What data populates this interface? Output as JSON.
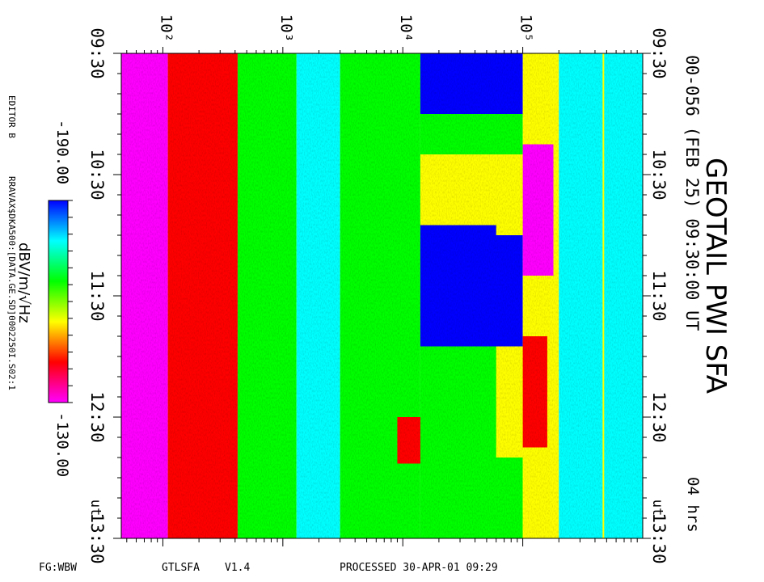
{
  "chart_data": {
    "type": "heatmap",
    "title": "GEOTAIL PWI SFA",
    "subtitle": "00-056 (FEB 25) 09:30:00 UT",
    "span_label": "04 hrs",
    "xscale": "log",
    "xlim": [
      45,
      1000000
    ],
    "x_ticks": [
      {
        "value": 100,
        "label": "10²"
      },
      {
        "value": 1000,
        "label": "10³"
      },
      {
        "value": 10000,
        "label": "10⁴"
      },
      {
        "value": 100000,
        "label": "10⁵"
      }
    ],
    "ylim": [
      "09:30",
      "13:30"
    ],
    "y_ticks": [
      "09:30",
      "10:30",
      "11:30",
      "12:30",
      "13:30"
    ],
    "y_unit_label": "UT",
    "colorbar": {
      "label": "dBV/m/√Hz",
      "min_label": "-190.00",
      "max_label": "-130.00",
      "min": -190,
      "max": -130,
      "colors": [
        "#ff00ff",
        "#ff0000",
        "#ffff00",
        "#00ff00",
        "#00ffff",
        "#0000ff"
      ]
    },
    "regions": [
      {
        "f_start": 45,
        "f_end": 110,
        "t_start": 0,
        "t_end": 240,
        "level": -133
      },
      {
        "f_start": 110,
        "f_end": 420,
        "t_start": 0,
        "t_end": 240,
        "level": -145
      },
      {
        "f_start": 420,
        "f_end": 1300,
        "t_start": 0,
        "t_end": 240,
        "level": -165
      },
      {
        "f_start": 1300,
        "f_end": 3000,
        "t_start": 0,
        "t_end": 240,
        "level": -175
      },
      {
        "f_start": 3000,
        "f_end": 14000,
        "t_start": 0,
        "t_end": 240,
        "level": -165
      },
      {
        "f_start": 14000,
        "f_end": 100000,
        "t_start": 0,
        "t_end": 30,
        "level": -190
      },
      {
        "f_start": 14000,
        "f_end": 100000,
        "t_start": 30,
        "t_end": 50,
        "level": -160
      },
      {
        "f_start": 14000,
        "f_end": 100000,
        "t_start": 50,
        "t_end": 85,
        "level": -155
      },
      {
        "f_start": 14000,
        "f_end": 100000,
        "t_start": 85,
        "t_end": 145,
        "level": -190
      },
      {
        "f_start": 14000,
        "f_end": 100000,
        "t_start": 145,
        "t_end": 240,
        "level": -165
      },
      {
        "f_start": 60000,
        "f_end": 100000,
        "t_start": 50,
        "t_end": 90,
        "level": -148
      },
      {
        "f_start": 60000,
        "f_end": 100000,
        "t_start": 145,
        "t_end": 200,
        "level": -150
      },
      {
        "f_start": 100000,
        "f_end": 200000,
        "t_start": 0,
        "t_end": 240,
        "level": -155
      },
      {
        "f_start": 100000,
        "f_end": 180000,
        "t_start": 45,
        "t_end": 110,
        "level": -135
      },
      {
        "f_start": 100000,
        "f_end": 160000,
        "t_start": 140,
        "t_end": 195,
        "level": -137
      },
      {
        "f_start": 100000,
        "f_end": 140000,
        "t_start": 195,
        "t_end": 240,
        "level": -150
      },
      {
        "f_start": 200000,
        "f_end": 1000000,
        "t_start": 0,
        "t_end": 240,
        "level": -180
      },
      {
        "f_start": 9000,
        "f_end": 14000,
        "t_start": 180,
        "t_end": 203,
        "level": -137
      }
    ],
    "marker_line_frequency": 470000
  },
  "footer": {
    "left": "FG:WBW",
    "program": "GTLSFA",
    "version": "V1.4",
    "processed": "PROCESSED 30-APR-01   09:29"
  },
  "side_notes": {
    "editor": "EDITOR B",
    "file_path": "RRAVAX$DKA500:[DATA.GE.SD]0002250I.S02:1"
  }
}
